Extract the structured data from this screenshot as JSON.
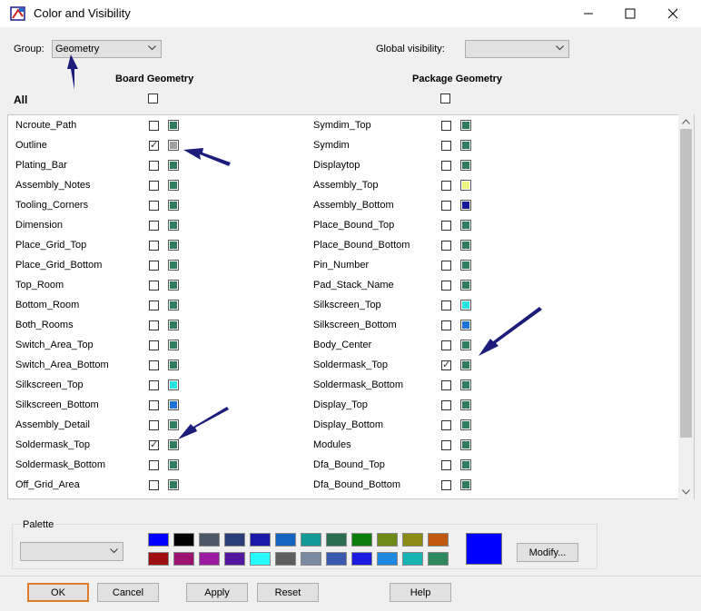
{
  "window": {
    "title": "Color and Visibility"
  },
  "group": {
    "label": "Group:",
    "value": "Geometry"
  },
  "global_visibility": {
    "label": "Global visibility:",
    "value": ""
  },
  "board": {
    "header": "Board Geometry"
  },
  "package": {
    "header": "Package Geometry"
  },
  "all_label": "All",
  "board_rows": [
    {
      "label": "Ncroute_Path",
      "checked": false,
      "color": "#2e7d5e"
    },
    {
      "label": "Outline",
      "checked": true,
      "color": "#a0a0a0"
    },
    {
      "label": "Plating_Bar",
      "checked": false,
      "color": "#2e7d5e"
    },
    {
      "label": "Assembly_Notes",
      "checked": false,
      "color": "#2e7d5e"
    },
    {
      "label": "Tooling_Corners",
      "checked": false,
      "color": "#2e7d5e"
    },
    {
      "label": "Dimension",
      "checked": false,
      "color": "#2e7d5e"
    },
    {
      "label": "Place_Grid_Top",
      "checked": false,
      "color": "#2e7d5e"
    },
    {
      "label": "Place_Grid_Bottom",
      "checked": false,
      "color": "#2e7d5e"
    },
    {
      "label": "Top_Room",
      "checked": false,
      "color": "#2e7d5e"
    },
    {
      "label": "Bottom_Room",
      "checked": false,
      "color": "#2e7d5e"
    },
    {
      "label": "Both_Rooms",
      "checked": false,
      "color": "#2e7d5e"
    },
    {
      "label": "Switch_Area_Top",
      "checked": false,
      "color": "#2e7d5e"
    },
    {
      "label": "Switch_Area_Bottom",
      "checked": false,
      "color": "#2e7d5e"
    },
    {
      "label": "Silkscreen_Top",
      "checked": false,
      "color": "#27e0e0"
    },
    {
      "label": "Silkscreen_Bottom",
      "checked": false,
      "color": "#1e74d8"
    },
    {
      "label": "Assembly_Detail",
      "checked": false,
      "color": "#2e7d5e"
    },
    {
      "label": "Soldermask_Top",
      "checked": true,
      "color": "#2e7d5e"
    },
    {
      "label": "Soldermask_Bottom",
      "checked": false,
      "color": "#2e7d5e"
    },
    {
      "label": "Off_Grid_Area",
      "checked": false,
      "color": "#2e7d5e"
    }
  ],
  "package_rows": [
    {
      "label": "Symdim_Top",
      "checked": false,
      "color": "#2e7d5e"
    },
    {
      "label": "Symdim",
      "checked": false,
      "color": "#2e7d5e"
    },
    {
      "label": "Displaytop",
      "checked": false,
      "color": "#2e7d5e"
    },
    {
      "label": "Assembly_Top",
      "checked": false,
      "color": "#eef582"
    },
    {
      "label": "Assembly_Bottom",
      "checked": false,
      "color": "#15159a"
    },
    {
      "label": "Place_Bound_Top",
      "checked": false,
      "color": "#2e7d5e"
    },
    {
      "label": "Place_Bound_Bottom",
      "checked": false,
      "color": "#2e7d5e"
    },
    {
      "label": "Pin_Number",
      "checked": false,
      "color": "#2e7d5e"
    },
    {
      "label": "Pad_Stack_Name",
      "checked": false,
      "color": "#2e7d5e"
    },
    {
      "label": "Silkscreen_Top",
      "checked": false,
      "color": "#27e0e0"
    },
    {
      "label": "Silkscreen_Bottom",
      "checked": false,
      "color": "#1e74d8"
    },
    {
      "label": "Body_Center",
      "checked": false,
      "color": "#2e7d5e"
    },
    {
      "label": "Soldermask_Top",
      "checked": true,
      "color": "#2e7d5e"
    },
    {
      "label": "Soldermask_Bottom",
      "checked": false,
      "color": "#2e7d5e"
    },
    {
      "label": "Display_Top",
      "checked": false,
      "color": "#2e7d5e"
    },
    {
      "label": "Display_Bottom",
      "checked": false,
      "color": "#2e7d5e"
    },
    {
      "label": "Modules",
      "checked": false,
      "color": "#2e7d5e"
    },
    {
      "label": "Dfa_Bound_Top",
      "checked": false,
      "color": "#2e7d5e"
    },
    {
      "label": "Dfa_Bound_Bottom",
      "checked": false,
      "color": "#2e7d5e"
    }
  ],
  "palette": {
    "label": "Palette",
    "value": "",
    "row1": [
      "#0000ff",
      "#000000",
      "#4d5866",
      "#2a3f7a",
      "#1a1aa8",
      "#1565c0",
      "#159a9a",
      "#2b6e4f",
      "#0b7d0b",
      "#6e8a16",
      "#8c8c14",
      "#c05a0e"
    ],
    "row2": [
      "#9e1010",
      "#9c1470",
      "#9a1aa0",
      "#5218a0",
      "#27ffff",
      "#5e5e5e",
      "#7a8aa0",
      "#3a5ab0",
      "#1a1ae0",
      "#1e88e0",
      "#18b4b4",
      "#2e8a5e"
    ],
    "current": "#0000ff",
    "modify_label": "Modify..."
  },
  "buttons": {
    "ok": "OK",
    "cancel": "Cancel",
    "apply": "Apply",
    "reset": "Reset",
    "help": "Help"
  }
}
